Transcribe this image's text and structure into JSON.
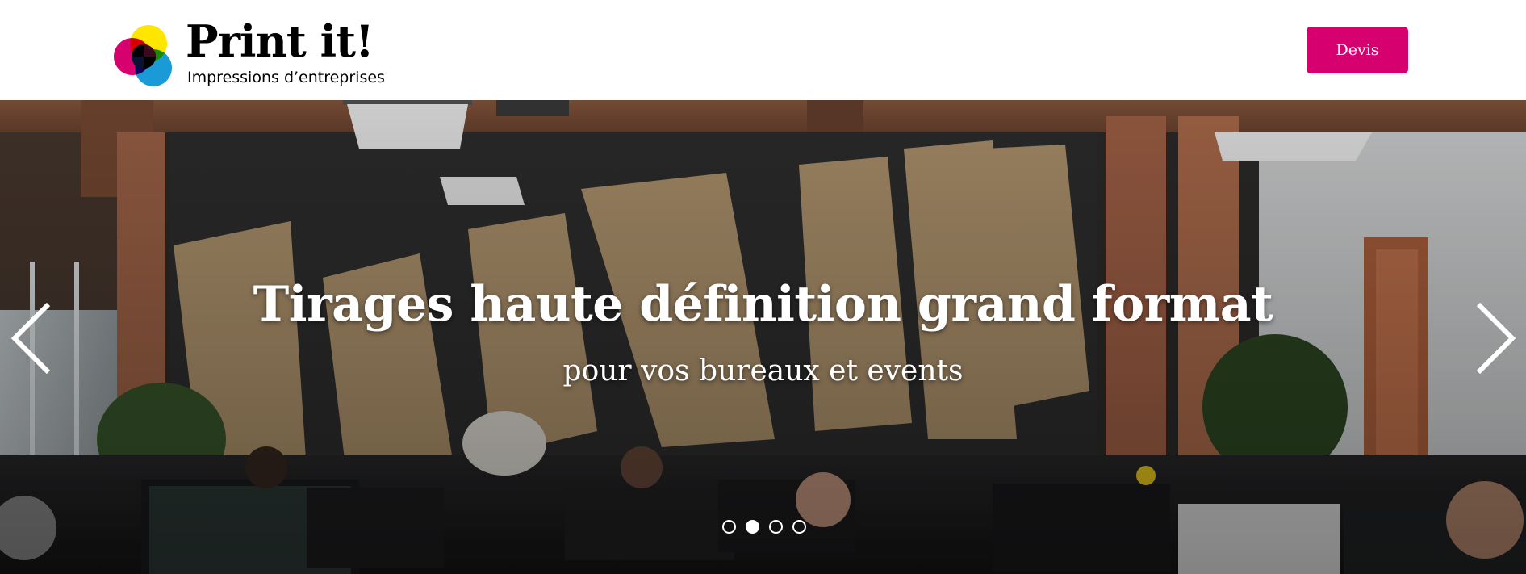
{
  "header": {
    "logo": {
      "title": "Print it!",
      "tagline": "Impressions d’entreprises",
      "icon": "cmyk-circles-logo"
    },
    "devis_label": "Devis"
  },
  "hero": {
    "title": "Tirages haute définition grand format",
    "subtitle": "pour vos bureaux et events",
    "prev_icon": "chevron-left-icon",
    "next_icon": "chevron-right-icon",
    "slides_count": 4,
    "active_slide": 2
  },
  "colors": {
    "accent": "#d6006f",
    "logo_yellow": "#ffe600",
    "logo_magenta": "#d6006f",
    "logo_cyan": "#1a9ad6",
    "logo_black": "#000000"
  }
}
